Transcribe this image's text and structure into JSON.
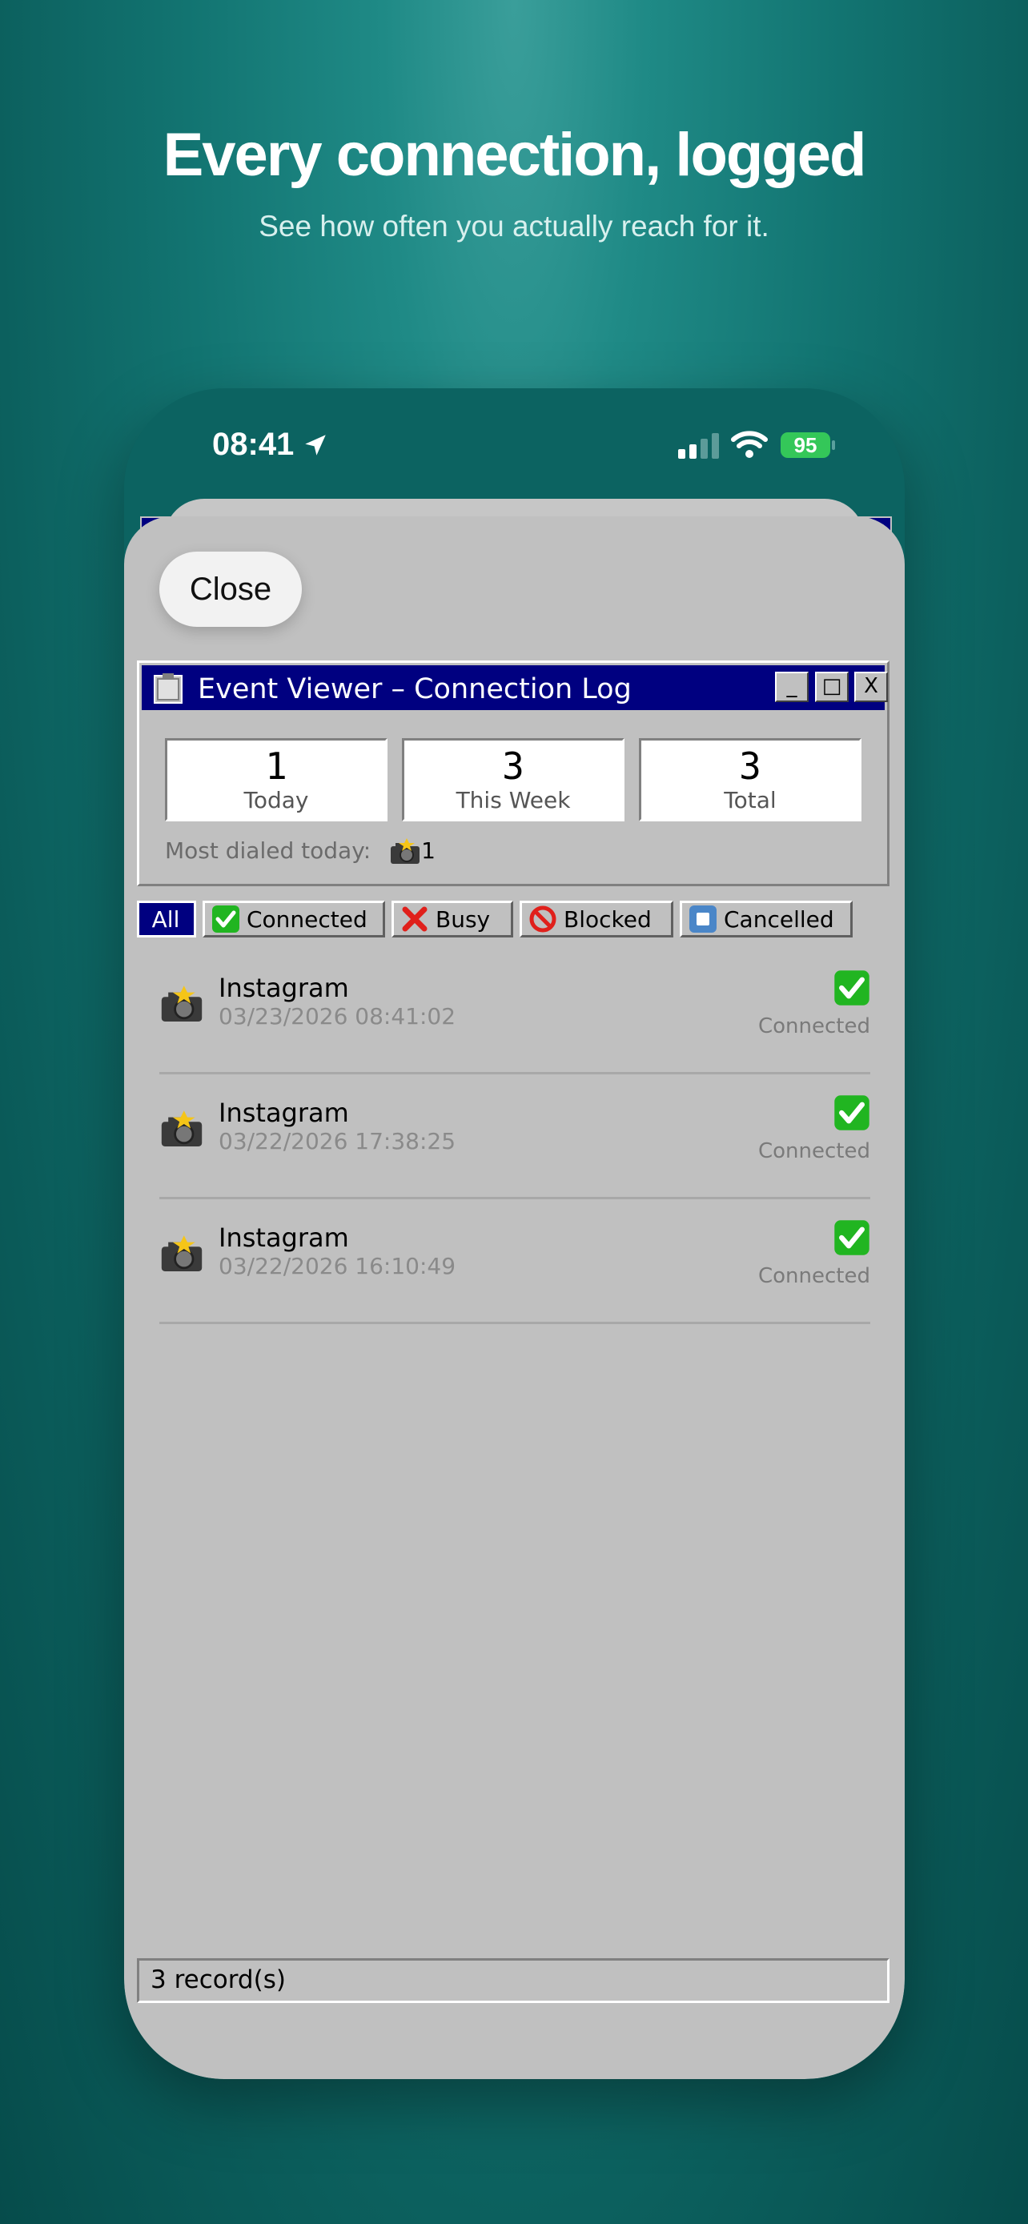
{
  "headline": "Every connection, logged",
  "subhead": "See how often you actually reach for it.",
  "status_bar": {
    "time": "08:41",
    "battery": "95"
  },
  "close_label": "Close",
  "window": {
    "title": "Event Viewer – Connection Log",
    "buttons": {
      "minimize": "_",
      "maximize": "□",
      "close": "X"
    }
  },
  "stats": [
    {
      "value": "1",
      "label": "Today"
    },
    {
      "value": "3",
      "label": "This Week"
    },
    {
      "value": "3",
      "label": "Total"
    }
  ],
  "most_dialed": {
    "label": "Most dialed today:",
    "count": "1"
  },
  "filters": [
    {
      "label": "All",
      "icon": "none",
      "active": true
    },
    {
      "label": "Connected",
      "icon": "check-icon"
    },
    {
      "label": "Busy",
      "icon": "x-icon"
    },
    {
      "label": "Blocked",
      "icon": "prohibited-icon"
    },
    {
      "label": "Cancelled",
      "icon": "stop-icon"
    }
  ],
  "records": [
    {
      "app": "Instagram",
      "timestamp": "03/23/2026 08:41:02",
      "status": "Connected"
    },
    {
      "app": "Instagram",
      "timestamp": "03/22/2026 17:38:25",
      "status": "Connected"
    },
    {
      "app": "Instagram",
      "timestamp": "03/22/2026 16:10:49",
      "status": "Connected"
    }
  ],
  "record_count": "3 record(s)",
  "colors": {
    "title_bar": "#000080",
    "window_gray": "#c0c0c0",
    "check_green": "#21b521",
    "background_teal": "#127471"
  }
}
